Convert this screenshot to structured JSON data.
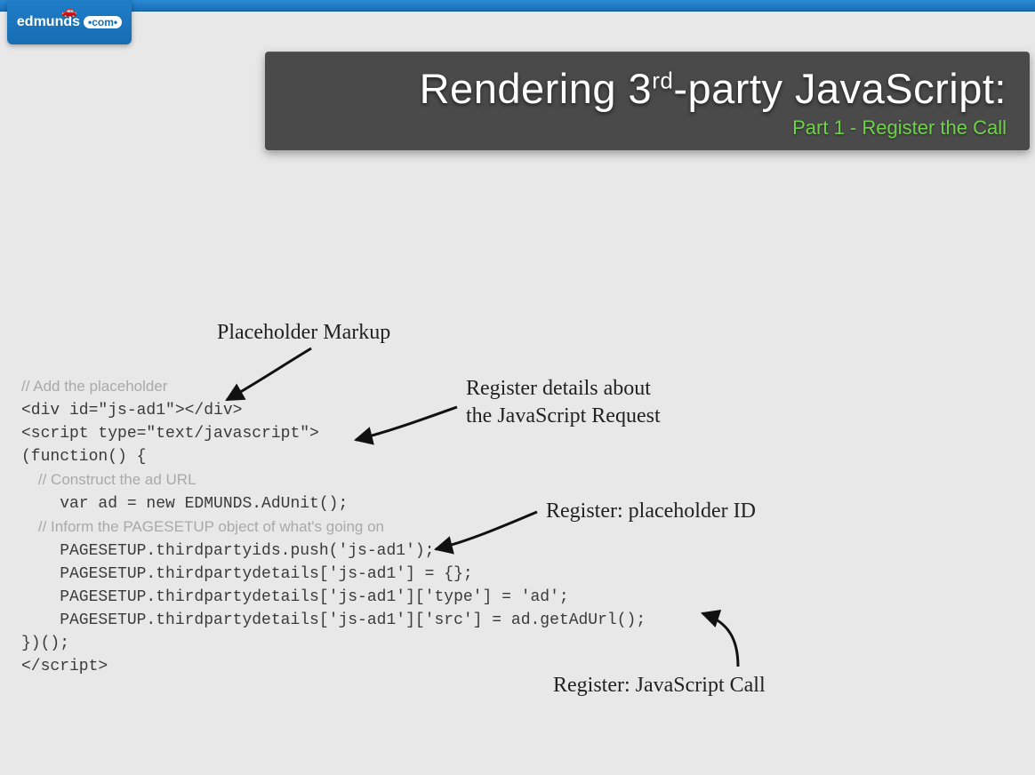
{
  "logo": {
    "brand": "edmunds",
    "bubble_text": "com"
  },
  "title": {
    "pre": "Rendering 3",
    "sup": "rd",
    "post": "-party JavaScript:"
  },
  "subtitle": "Part 1 - Register the Call",
  "annotations": {
    "placeholder_markup": "Placeholder Markup",
    "register_details": "Register details about\nthe JavaScript Request",
    "register_placeholder_id": "Register: placeholder ID",
    "register_js_call": "Register: JavaScript Call"
  },
  "code": {
    "c1": "// Add the placeholder",
    "l1": "<div id=\"js-ad1\"></div>",
    "l2": "<script type=\"text/javascript\">",
    "l3": "(function() {",
    "c2": "    // Construct the ad URL",
    "l4": "    var ad = new EDMUNDS.AdUnit();",
    "c3": "    // Inform the PAGESETUP object of what's going on",
    "l5": "    PAGESETUP.thirdpartyids.push('js-ad1');",
    "l6": "    PAGESETUP.thirdpartydetails['js-ad1'] = {};",
    "l7": "    PAGESETUP.thirdpartydetails['js-ad1']['type'] = 'ad';",
    "l8": "    PAGESETUP.thirdpartydetails['js-ad1']['src'] = ad.getAdUrl();",
    "l9": "})();",
    "l10": "</script>"
  }
}
